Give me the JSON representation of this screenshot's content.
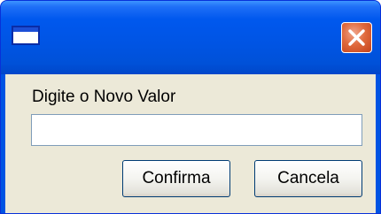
{
  "window": {
    "title": "",
    "colors": {
      "titlebar": "#0054e3",
      "client": "#ece9d8",
      "close_button": "#e06a3d"
    }
  },
  "icons": {
    "window_icon": "window-icon",
    "close_icon": "close-x-icon"
  },
  "dialog": {
    "prompt": "Digite o Novo Valor",
    "input_value": "",
    "confirm_label": "Confirma",
    "cancel_label": "Cancela"
  }
}
